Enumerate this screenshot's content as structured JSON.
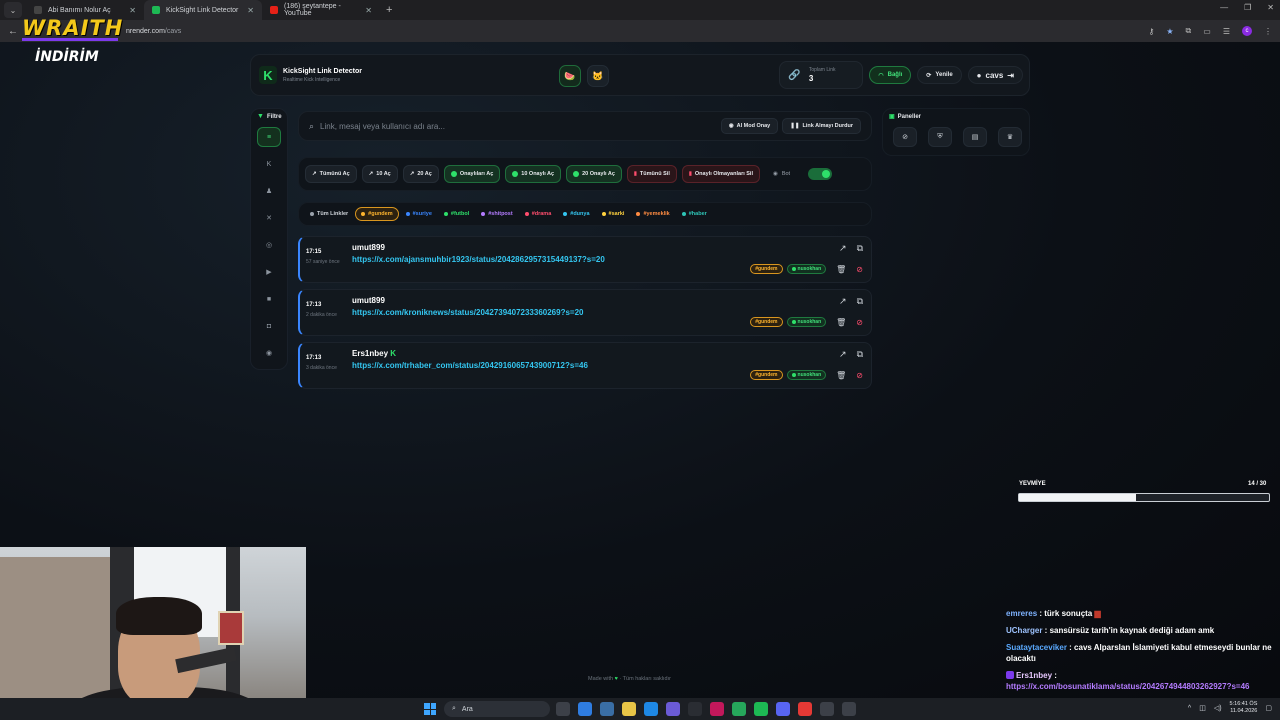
{
  "browser": {
    "tabs": [
      {
        "title": "Abi Banımı Nolur Aç"
      },
      {
        "title": "KickSight Link Detector"
      },
      {
        "title": "(186) şeytantepe - YouTube"
      }
    ],
    "url_main": "nrender.com",
    "url_path": "/cavs"
  },
  "overlay": {
    "wraith": "WRAITH",
    "indirim": "İNDİRİM"
  },
  "header": {
    "title": "KickSight Link Detector",
    "subtitle": "Realtime Kick Intelligence",
    "stat_label": "Toplam Link",
    "stat_value": "3",
    "connected_label": "Bağlı",
    "refresh_label": "Yenile",
    "user_label": "cavs"
  },
  "sidebar": {
    "title": "Filtre",
    "items": [
      {
        "icon": "list-icon",
        "glyph": "≡"
      },
      {
        "icon": "kick-icon",
        "glyph": "K"
      },
      {
        "icon": "users-icon",
        "glyph": "♟"
      },
      {
        "icon": "x-icon",
        "glyph": "✕"
      },
      {
        "icon": "instagram-icon",
        "glyph": "◎"
      },
      {
        "icon": "youtube-icon",
        "glyph": "▶"
      },
      {
        "icon": "video-icon",
        "glyph": "■"
      },
      {
        "icon": "camera-icon",
        "glyph": "◘"
      },
      {
        "icon": "globe-icon",
        "glyph": "◉"
      }
    ]
  },
  "search": {
    "placeholder": "Link, mesaj veya kullanıcı adı ara...",
    "ai_button": "AI Mod Onay",
    "stop_button": "Link Almayı Durdur"
  },
  "actions": {
    "open_all": "Tümünü Aç",
    "open_10": "10 Aç",
    "open_20": "20 Aç",
    "open_approved": "Onaylıları Aç",
    "open_10_approved": "10 Onaylı Aç",
    "open_20_approved": "20 Onaylı Aç",
    "delete_all": "Tümünü Sil",
    "delete_unapproved": "Onaylı Olmayanları Sil",
    "bot_label": "Bot"
  },
  "tags": [
    {
      "label": "Tüm Linkler",
      "color": "#9aa2ac"
    },
    {
      "label": "#gundem",
      "color": "#ffb52e",
      "active": true
    },
    {
      "label": "#suriye",
      "color": "#3a86ff"
    },
    {
      "label": "#futbol",
      "color": "#2ee06a"
    },
    {
      "label": "#shitpost",
      "color": "#b47cff"
    },
    {
      "label": "#drama",
      "color": "#ff4d6d"
    },
    {
      "label": "#dunya",
      "color": "#34c6f0"
    },
    {
      "label": "#sarki",
      "color": "#ffd23f"
    },
    {
      "label": "#yemeklik",
      "color": "#ff8c42"
    },
    {
      "label": "#haber",
      "color": "#2ec4b6"
    }
  ],
  "links": [
    {
      "time": "17:15",
      "ago": "57 saniye önce",
      "user": "umut899",
      "verified": false,
      "url": "https://x.com/ajansmuhbir1923/status/2042862957315449137?s=20",
      "tag": "#gundem",
      "approver": "nusokhan"
    },
    {
      "time": "17:13",
      "ago": "2 dakika önce",
      "user": "umut899",
      "verified": false,
      "url": "https://x.com/kroniknews/status/2042739407233360269?s=20",
      "tag": "#gundem",
      "approver": "nusokhan"
    },
    {
      "time": "17:13",
      "ago": "3 dakika önce",
      "user": "Ers1nbey",
      "verified": true,
      "url": "https://x.com/trhaber_com/status/2042916065743900712?s=46",
      "tag": "#gundem",
      "approver": "nusokhan"
    }
  ],
  "panels": {
    "title": "Paneller"
  },
  "footer": {
    "made_with": "Made with",
    "rights": "· Tüm hakları saklıdır"
  },
  "yevmiye": {
    "label": "YEVMİYE",
    "count": "14 / 30",
    "progress": 0.467
  },
  "chat": [
    {
      "name": "emreres",
      "text": "türk sonuçta"
    },
    {
      "name": "UCharger",
      "text": "sansürsüz tarih'in kaynak dediği adam amk"
    },
    {
      "name": "Suataytaceviker",
      "text": "cavs Alparslan İslamiyeti kabul etmeseydi bunlar ne olacaktı"
    },
    {
      "name": "Ers1nbey",
      "text": "",
      "url": "https://x.com/bosunatiklama/status/2042674944803262927?s=46"
    }
  ],
  "taskbar": {
    "search_label": "Ara",
    "time": "5:16:41 ÖS",
    "date": "11.04.2026"
  },
  "colors": {
    "accent": "#2ee06a",
    "link": "#34c6f0",
    "danger": "#ff4d6d",
    "amber": "#ffb52e"
  }
}
